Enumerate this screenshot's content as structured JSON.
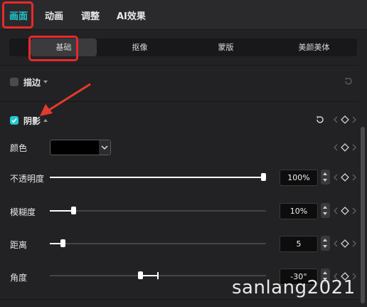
{
  "top_tabs": [
    "画面",
    "动画",
    "调整",
    "AI效果"
  ],
  "sub_tabs": [
    "基础",
    "抠像",
    "蒙版",
    "美颜美体"
  ],
  "stroke": {
    "label": "描边",
    "checked": false
  },
  "shadow": {
    "label": "阴影",
    "checked": true,
    "color_label": "颜色",
    "color_value": "#000000",
    "opacity": {
      "label": "不透明度",
      "value": "100%",
      "fraction": 1.0
    },
    "blur": {
      "label": "模糊度",
      "value": "10%",
      "fraction": 0.1
    },
    "distance": {
      "label": "距离",
      "value": "5",
      "fraction": 0.05
    },
    "angle": {
      "label": "角度",
      "value": "-30°"
    }
  },
  "watermark": "sanlang2021",
  "colors": {
    "accent": "#21c8cf",
    "highlight": "#e8292a",
    "arrow": "#e33a2c"
  }
}
